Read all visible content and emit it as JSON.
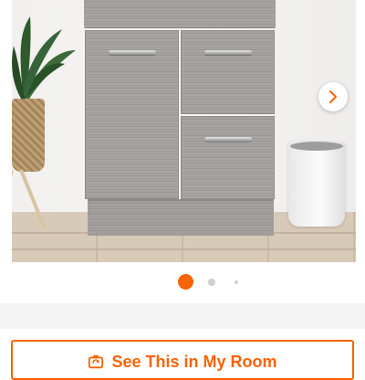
{
  "carousel": {
    "next_icon": "chevron-right-icon",
    "accent_color": "#f96302",
    "total_images": 3,
    "active_index": 0
  },
  "room_button": {
    "label": "See This in My Room",
    "icon": "camera-rotate-icon"
  }
}
